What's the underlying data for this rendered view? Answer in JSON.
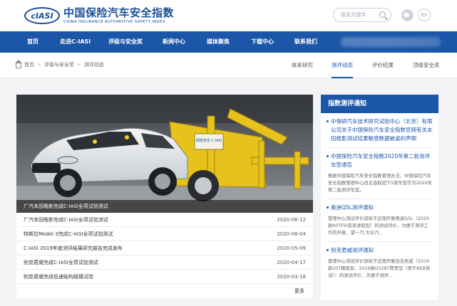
{
  "header": {
    "logo_badge": "cIASI",
    "logo_cn": "中国保险汽车安全指数",
    "logo_en": "CHINA INSURANCE AUTOMOTIVE SAFETY INDEX",
    "search_placeholder": "搜索关键字",
    "lang_label": "En"
  },
  "nav": {
    "items": [
      "首页",
      "走进C-IASI",
      "评级与安全奖",
      "新闻中心",
      "媒体聚焦",
      "下载中心",
      "联系我们"
    ]
  },
  "breadcrumb": {
    "items": [
      "首页",
      "评级与安全奖",
      "测评动态"
    ]
  },
  "subtabs": {
    "items": [
      "体系研究",
      "测评动态",
      "评价结果",
      "顶级安全奖"
    ],
    "active": "测评动态"
  },
  "feature": {
    "caption": "广汽本田皓影完成C-IASI全项试验测试",
    "barrier_label": "保险安全 C-IASI"
  },
  "news": [
    {
      "title": "广汽本田皓影完成C-IASI全项试验测试",
      "date": "2020-06-12"
    },
    {
      "title": "特斯拉Model 3完成C-IASI全项试验测试",
      "date": "2020-06-04"
    },
    {
      "title": "C-IASI 2019年度测评结果研究报告完成发布",
      "date": "2020-05-09"
    },
    {
      "title": "别克君威完成C-IASI全项试验测试",
      "date": "2020-04-17"
    },
    {
      "title": "别克君威完成低速结构碰撞试验",
      "date": "2020-03-18"
    }
  ],
  "more_label": "更多",
  "sidebar": {
    "heading": "指数测评通知",
    "items": [
      {
        "title": "中保研汽车技术研究试验中心（北京）有限公司关于中国保险汽车安全指数官网有关本田皓影测试结果敏感数据被盗的声明",
        "desc": ""
      },
      {
        "title": "中国保险汽车安全指数2020年第二批测评车型通告",
        "desc": "根据中国保险汽车安全指数管理办法，中国保险汽车安全指数管理中心自主选取如下5款车型作为2020年第二批测评车型。"
      },
      {
        "title": "奥迪Q5L测评通知",
        "desc": "管理中心测试评价部拟于近期开展奥迪Q5L（2020款40TFSI荣享进取型）的测试评价，为便于测评工作的开展，望一汽-大众汽..."
      },
      {
        "title": "别克君威测评通知",
        "desc": "管理中心测试评价部拟于近期开展别克君威（2019款20T精英型、2019款GS28T尊贵型（用于AEB测试））的测试评价，为便于测评..."
      }
    ]
  },
  "colors": {
    "primary": "#1b56a8",
    "logo_blue": "#1a4f95"
  }
}
